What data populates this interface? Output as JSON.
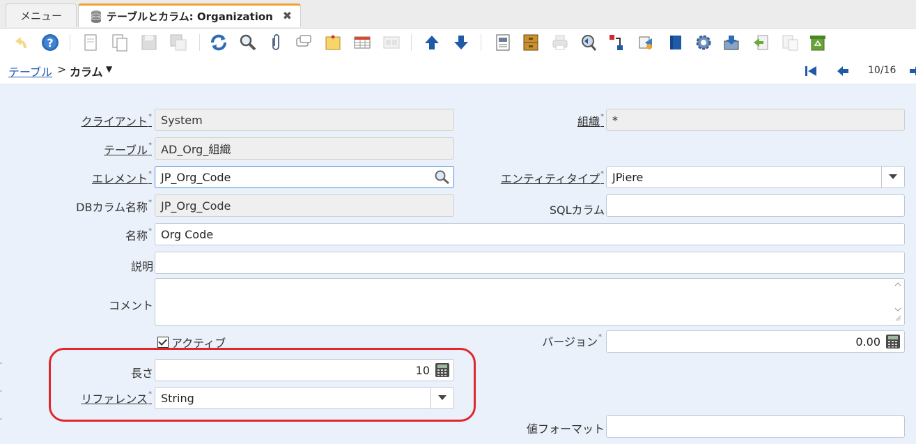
{
  "tabs": {
    "menu_label": "メニュー",
    "active_label": "テーブルとカラム: Organization",
    "close_glyph": "✖"
  },
  "toolbar": {
    "icons": [
      "undo-icon",
      "help-icon",
      "new-record-icon",
      "copy-record-icon",
      "save-icon",
      "save-new-icon",
      "refresh-icon",
      "find-icon",
      "attachment-icon",
      "chat-icon",
      "postit-icon",
      "grid-toggle-icon",
      "detail-icon",
      "previous-record-arrow-icon",
      "next-record-arrow-icon",
      "report-icon",
      "archive-icon",
      "print-icon",
      "zoom-across-icon",
      "request-icon",
      "product-info-icon",
      "workflow-icon",
      "process-icon",
      "export-icon",
      "import-icon",
      "copy-details-icon",
      "recycle-icon"
    ]
  },
  "breadcrumb": {
    "parent": "テーブル",
    "separator": ">",
    "current": "カラム",
    "pager": "10/16"
  },
  "form": {
    "client": {
      "label": "クライアント",
      "value": "System"
    },
    "org": {
      "label": "組織",
      "value": "*"
    },
    "table": {
      "label": "テーブル",
      "value": "AD_Org_組織"
    },
    "element": {
      "label": "エレメント",
      "value": "JP_Org_Code"
    },
    "entity_type": {
      "label": "エンティティタイプ",
      "value": "JPiere"
    },
    "db_column": {
      "label": "DBカラム名称",
      "value": "JP_Org_Code"
    },
    "sql_column": {
      "label": "SQLカラム",
      "value": ""
    },
    "name": {
      "label": "名称",
      "value": "Org Code"
    },
    "description": {
      "label": "説明",
      "value": ""
    },
    "comment": {
      "label": "コメント",
      "value": ""
    },
    "active": {
      "label": "アクティブ",
      "checked": true
    },
    "version": {
      "label": "バージョン",
      "value": "0.00"
    },
    "length": {
      "label": "長さ",
      "value": "10"
    },
    "reference": {
      "label": "リファレンス",
      "value": "String"
    },
    "value_format": {
      "label": "値フォーマット",
      "value": ""
    },
    "required_mark": "*"
  },
  "colors": {
    "accent_tab": "#f0a22e",
    "link": "#1d5ab5",
    "form_bg": "#eaf1fa",
    "highlight": "#e0272c"
  }
}
